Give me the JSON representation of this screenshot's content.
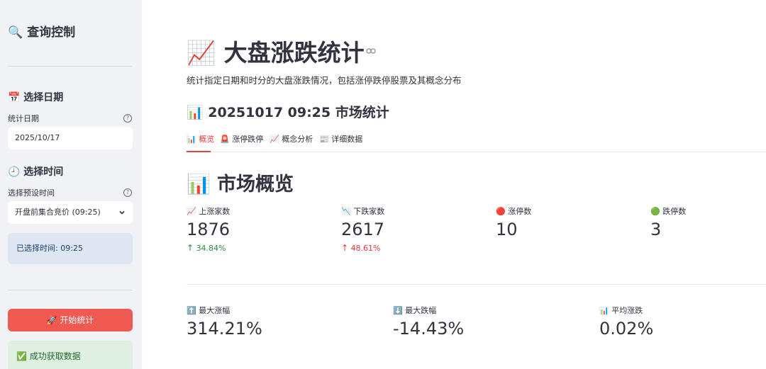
{
  "sidebar": {
    "title": "🔍 查询控制",
    "date_section": "📅 选择日期",
    "date_label": "统计日期",
    "date_value": "2025/10/17",
    "time_section": "🕘 选择时间",
    "time_label": "选择预设时间",
    "time_value": "开盘前集合竞价 (09:25)",
    "selected_time": "已选择时间: 09:25",
    "start_button": "🚀 开始统计",
    "success_message": "✅ 成功获取数据",
    "help_glyph": "?"
  },
  "main": {
    "title": "📈 大盘涨跌统计",
    "subtitle": "统计指定日期和时分的大盘涨跌情况，包括涨停跌停股票及其概念分布",
    "stat_title": "📊 20251017 09:25 市场统计",
    "tabs": [
      {
        "label": "📊 概览"
      },
      {
        "label": "🚨 涨停跌停"
      },
      {
        "label": "📈 概念分析"
      },
      {
        "label": "📰 详细数据"
      }
    ],
    "section_title": "📊 市场概览",
    "metrics_row1": [
      {
        "label": "📈 上涨家数",
        "value": "1876",
        "delta": "34.84%"
      },
      {
        "label": "📉 下跌家数",
        "value": "2617",
        "delta": "48.61%"
      },
      {
        "label": "🔴 涨停数",
        "value": "10"
      },
      {
        "label": "🟢 跌停数",
        "value": "3"
      }
    ],
    "metrics_row2": [
      {
        "label": "⬆️ 最大涨幅",
        "value": "314.21%"
      },
      {
        "label": "⬇️ 最大跌幅",
        "value": "-14.43%"
      },
      {
        "label": "📊 平均涨跌",
        "value": "0.02%"
      }
    ]
  },
  "icons": {
    "link": "link-icon",
    "chevron": "chevron-down-icon",
    "delta_arrow": "arrow-up-icon"
  },
  "colors": {
    "primary": "#ee5a52",
    "tab_active": "#ee3b3b",
    "delta_green": "#2f8a3b",
    "delta_red": "#e23b3b",
    "sidebar_bg": "#f0f2f6"
  }
}
